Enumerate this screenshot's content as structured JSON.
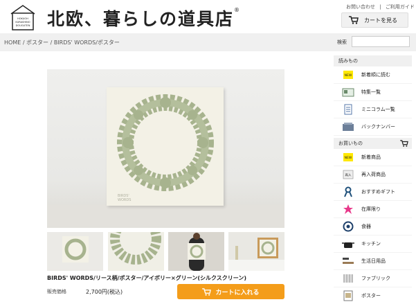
{
  "header": {
    "logo_text": "北欧、暮らしの道具店",
    "logo_mark": "®",
    "logo_box_text": "HOKUOH KURASHINO DOUGUTEN",
    "link_contact": "お問い合わせ",
    "separator": "|",
    "link_guide": "ご利用ガイド",
    "cart_button": "カートを見る"
  },
  "breadcrumb": {
    "text": "HOME / ポスター / BIRDS' WORDS/ポスター"
  },
  "search": {
    "label": "検索",
    "placeholder": ""
  },
  "product": {
    "title": "BIRDS' WORDS/リース柄/ポスター/アイボリー×グリーン(シルクスクリーン)",
    "price_label": "販売価格",
    "price": "2,700円(税込)",
    "buy_button": "カートに入れる"
  },
  "sidebar": {
    "read_header": "読みもの",
    "read_items": [
      {
        "label": "新着順に読む",
        "icon": "new-badge-icon"
      },
      {
        "label": "特集一覧",
        "icon": "feature-icon"
      },
      {
        "label": "ミニコラム一覧",
        "icon": "column-icon"
      },
      {
        "label": "バックナンバー",
        "icon": "backnumber-icon"
      }
    ],
    "shop_header": "お買いもの",
    "shop_items": [
      {
        "label": "新着商品",
        "icon": "new-badge-icon"
      },
      {
        "label": "再入荷商品",
        "icon": "restock-icon"
      },
      {
        "label": "おすすめギフト",
        "icon": "ribbon-icon"
      },
      {
        "label": "在庫限り",
        "icon": "star-icon"
      },
      {
        "label": "食器",
        "icon": "dish-icon"
      },
      {
        "label": "キッチン",
        "icon": "pot-icon"
      },
      {
        "label": "生活日用品",
        "icon": "brush-icon"
      },
      {
        "label": "ファブリック",
        "icon": "fabric-icon"
      },
      {
        "label": "ポスター",
        "icon": "poster-icon"
      }
    ],
    "new_badge": "NEW",
    "restock_badge": "再入"
  },
  "colors": {
    "accent": "#f49d1a",
    "wreath": "#a7b38e",
    "sidebar_header": "#f0f0f0"
  }
}
